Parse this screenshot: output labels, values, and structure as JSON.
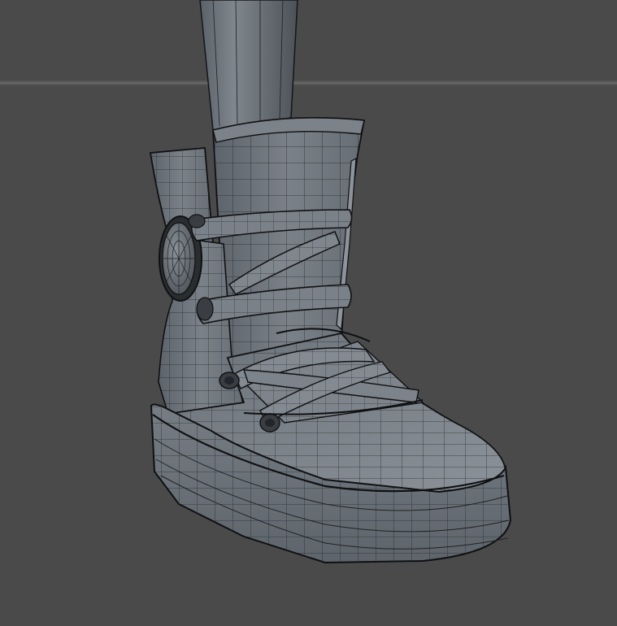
{
  "viewport": {
    "background_color": "#4a4a4a",
    "horizon_color": "#6a6a6a",
    "mesh_fill": "#6e757c",
    "mesh_fill_dark": "#545b62",
    "mesh_fill_light": "#8a9198",
    "wire_color": "#1e2124",
    "edge_color": "#0f1012"
  },
  "scene": {
    "object": "boot-mesh",
    "shading": "wireframe-on-shaded"
  }
}
